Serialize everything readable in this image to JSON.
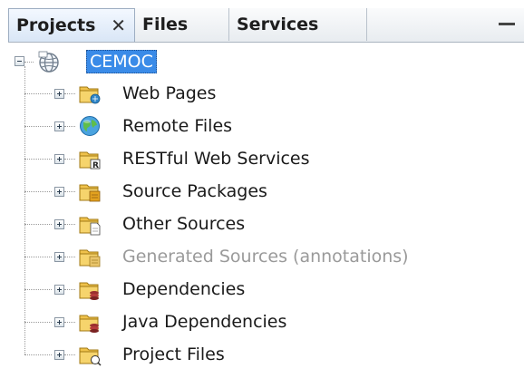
{
  "tabs": [
    {
      "label": "Projects",
      "active": true,
      "close_glyph": "✕"
    },
    {
      "label": "Files",
      "active": false
    },
    {
      "label": "Services",
      "active": false
    }
  ],
  "window_controls": {
    "minimize_icon": "minimize-icon"
  },
  "tree": {
    "root": {
      "label": "CEMOC",
      "icon": "web-project-icon",
      "expanded": true,
      "selected": true
    },
    "children": [
      {
        "label": "Web Pages",
        "icon": "web-pages-folder-icon",
        "expanded": false,
        "disabled": false
      },
      {
        "label": "Remote Files",
        "icon": "globe-icon",
        "expanded": false,
        "disabled": false
      },
      {
        "label": "RESTful Web Services",
        "icon": "rest-services-folder-icon",
        "expanded": false,
        "disabled": false
      },
      {
        "label": "Source Packages",
        "icon": "source-packages-folder-icon",
        "expanded": false,
        "disabled": false
      },
      {
        "label": "Other Sources",
        "icon": "other-sources-folder-icon",
        "expanded": false,
        "disabled": false
      },
      {
        "label": "Generated Sources (annotations)",
        "icon": "generated-sources-folder-icon",
        "expanded": false,
        "disabled": true
      },
      {
        "label": "Dependencies",
        "icon": "dependencies-folder-icon",
        "expanded": false,
        "disabled": false
      },
      {
        "label": "Java Dependencies",
        "icon": "java-dependencies-folder-icon",
        "expanded": false,
        "disabled": false
      },
      {
        "label": "Project Files",
        "icon": "project-files-folder-icon",
        "expanded": false,
        "disabled": false
      }
    ]
  },
  "colors": {
    "selection": "#3a8be8",
    "folder": "#e8b53c",
    "disabled_text": "#9a9a9a"
  }
}
